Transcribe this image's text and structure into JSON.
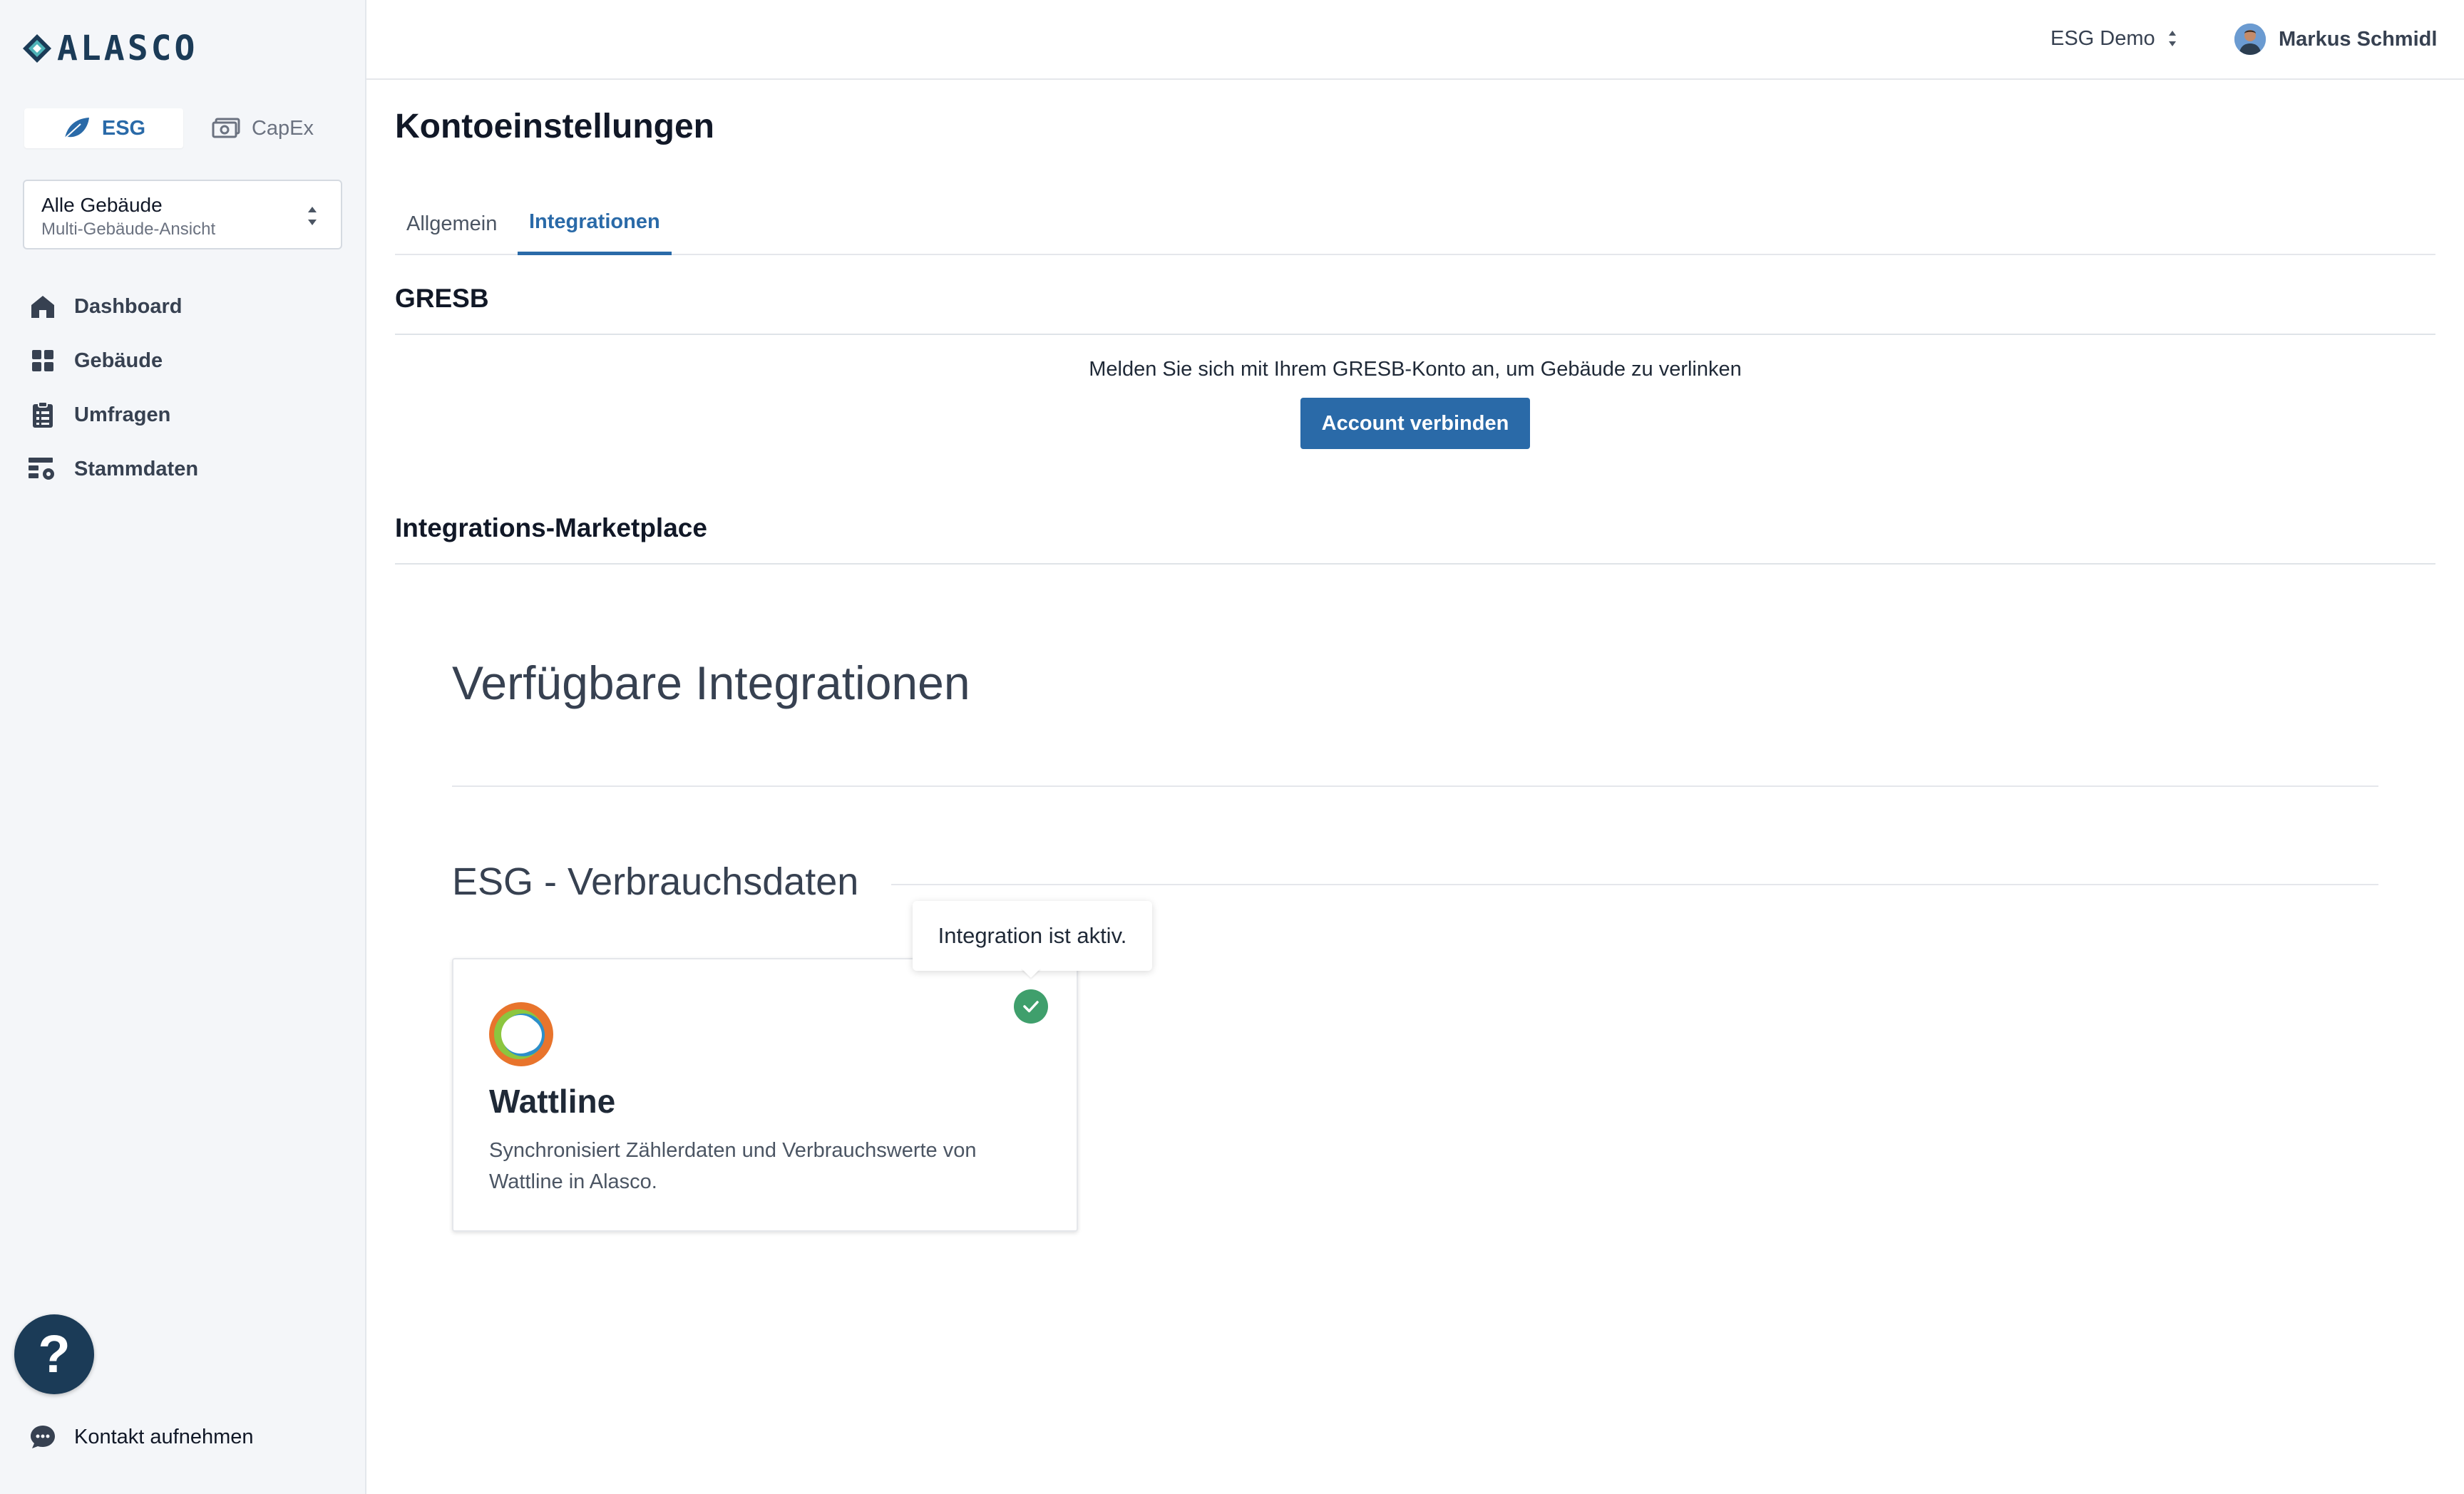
{
  "app": {
    "logo_text": "ALASCO"
  },
  "sidebar": {
    "modes": [
      {
        "label": "ESG",
        "icon": "leaf-icon",
        "active": true
      },
      {
        "label": "CapEx",
        "icon": "money-icon",
        "active": false
      }
    ],
    "building_select": {
      "title": "Alle Gebäude",
      "subtitle": "Multi-Gebäude-Ansicht"
    },
    "nav": [
      {
        "label": "Dashboard",
        "icon": "home-icon"
      },
      {
        "label": "Gebäude",
        "icon": "grid-icon"
      },
      {
        "label": "Umfragen",
        "icon": "clipboard-icon"
      },
      {
        "label": "Stammdaten",
        "icon": "settings-table-icon"
      }
    ],
    "help_label": "?",
    "contact_label": "Kontakt aufnehmen"
  },
  "topbar": {
    "org": "ESG Demo",
    "user": "Markus Schmidl"
  },
  "page": {
    "title": "Kontoeinstellungen",
    "tabs": [
      {
        "label": "Allgemein",
        "active": false
      },
      {
        "label": "Integrationen",
        "active": true
      }
    ]
  },
  "gresb": {
    "heading": "GRESB",
    "text": "Melden Sie sich mit Ihrem GRESB-Konto an, um Gebäude zu verlinken",
    "button": "Account verbinden"
  },
  "marketplace": {
    "heading": "Integrations-Marketplace",
    "title": "Verfügbare Integrationen",
    "category": "ESG - Verbrauchsdaten",
    "card": {
      "title": "Wattline",
      "description": "Synchronisiert Zählerdaten und Verbrauchswerte von Wattline in Alasco.",
      "status": "active"
    },
    "tooltip": "Integration ist aktiv."
  },
  "colors": {
    "accent": "#2a6aa8",
    "brand": "#1b3b57",
    "success": "#3f9f6c",
    "sidebar_bg": "#f4f6f9"
  }
}
